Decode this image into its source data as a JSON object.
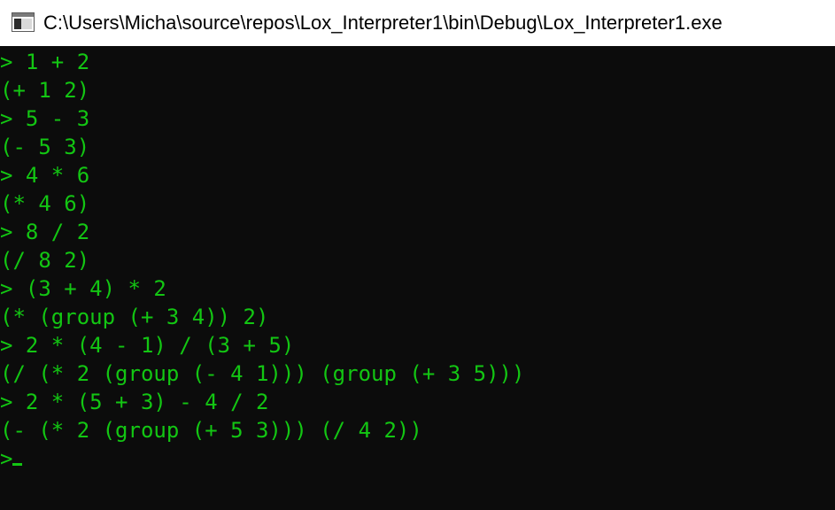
{
  "window": {
    "title": "C:\\Users\\Micha\\source\\repos\\Lox_Interpreter1\\bin\\Debug\\Lox_Interpreter1.exe",
    "icon": "console-app-icon"
  },
  "console": {
    "lines": [
      "> 1 + 2",
      "(+ 1 2)",
      "> 5 - 3",
      "(- 5 3)",
      "> 4 * 6",
      "(* 4 6)",
      "> 8 / 2",
      "(/ 8 2)",
      "> (3 + 4) * 2",
      "(* (group (+ 3 4)) 2)",
      "> 2 * (4 - 1) / (3 + 5)",
      "(/ (* 2 (group (- 4 1))) (group (+ 3 5)))",
      "> 2 * (5 + 3) - 4 / 2",
      "(- (* 2 (group (+ 5 3))) (/ 4 2))",
      ">"
    ],
    "text_color": "#13c613",
    "background": "#0c0c0c"
  }
}
